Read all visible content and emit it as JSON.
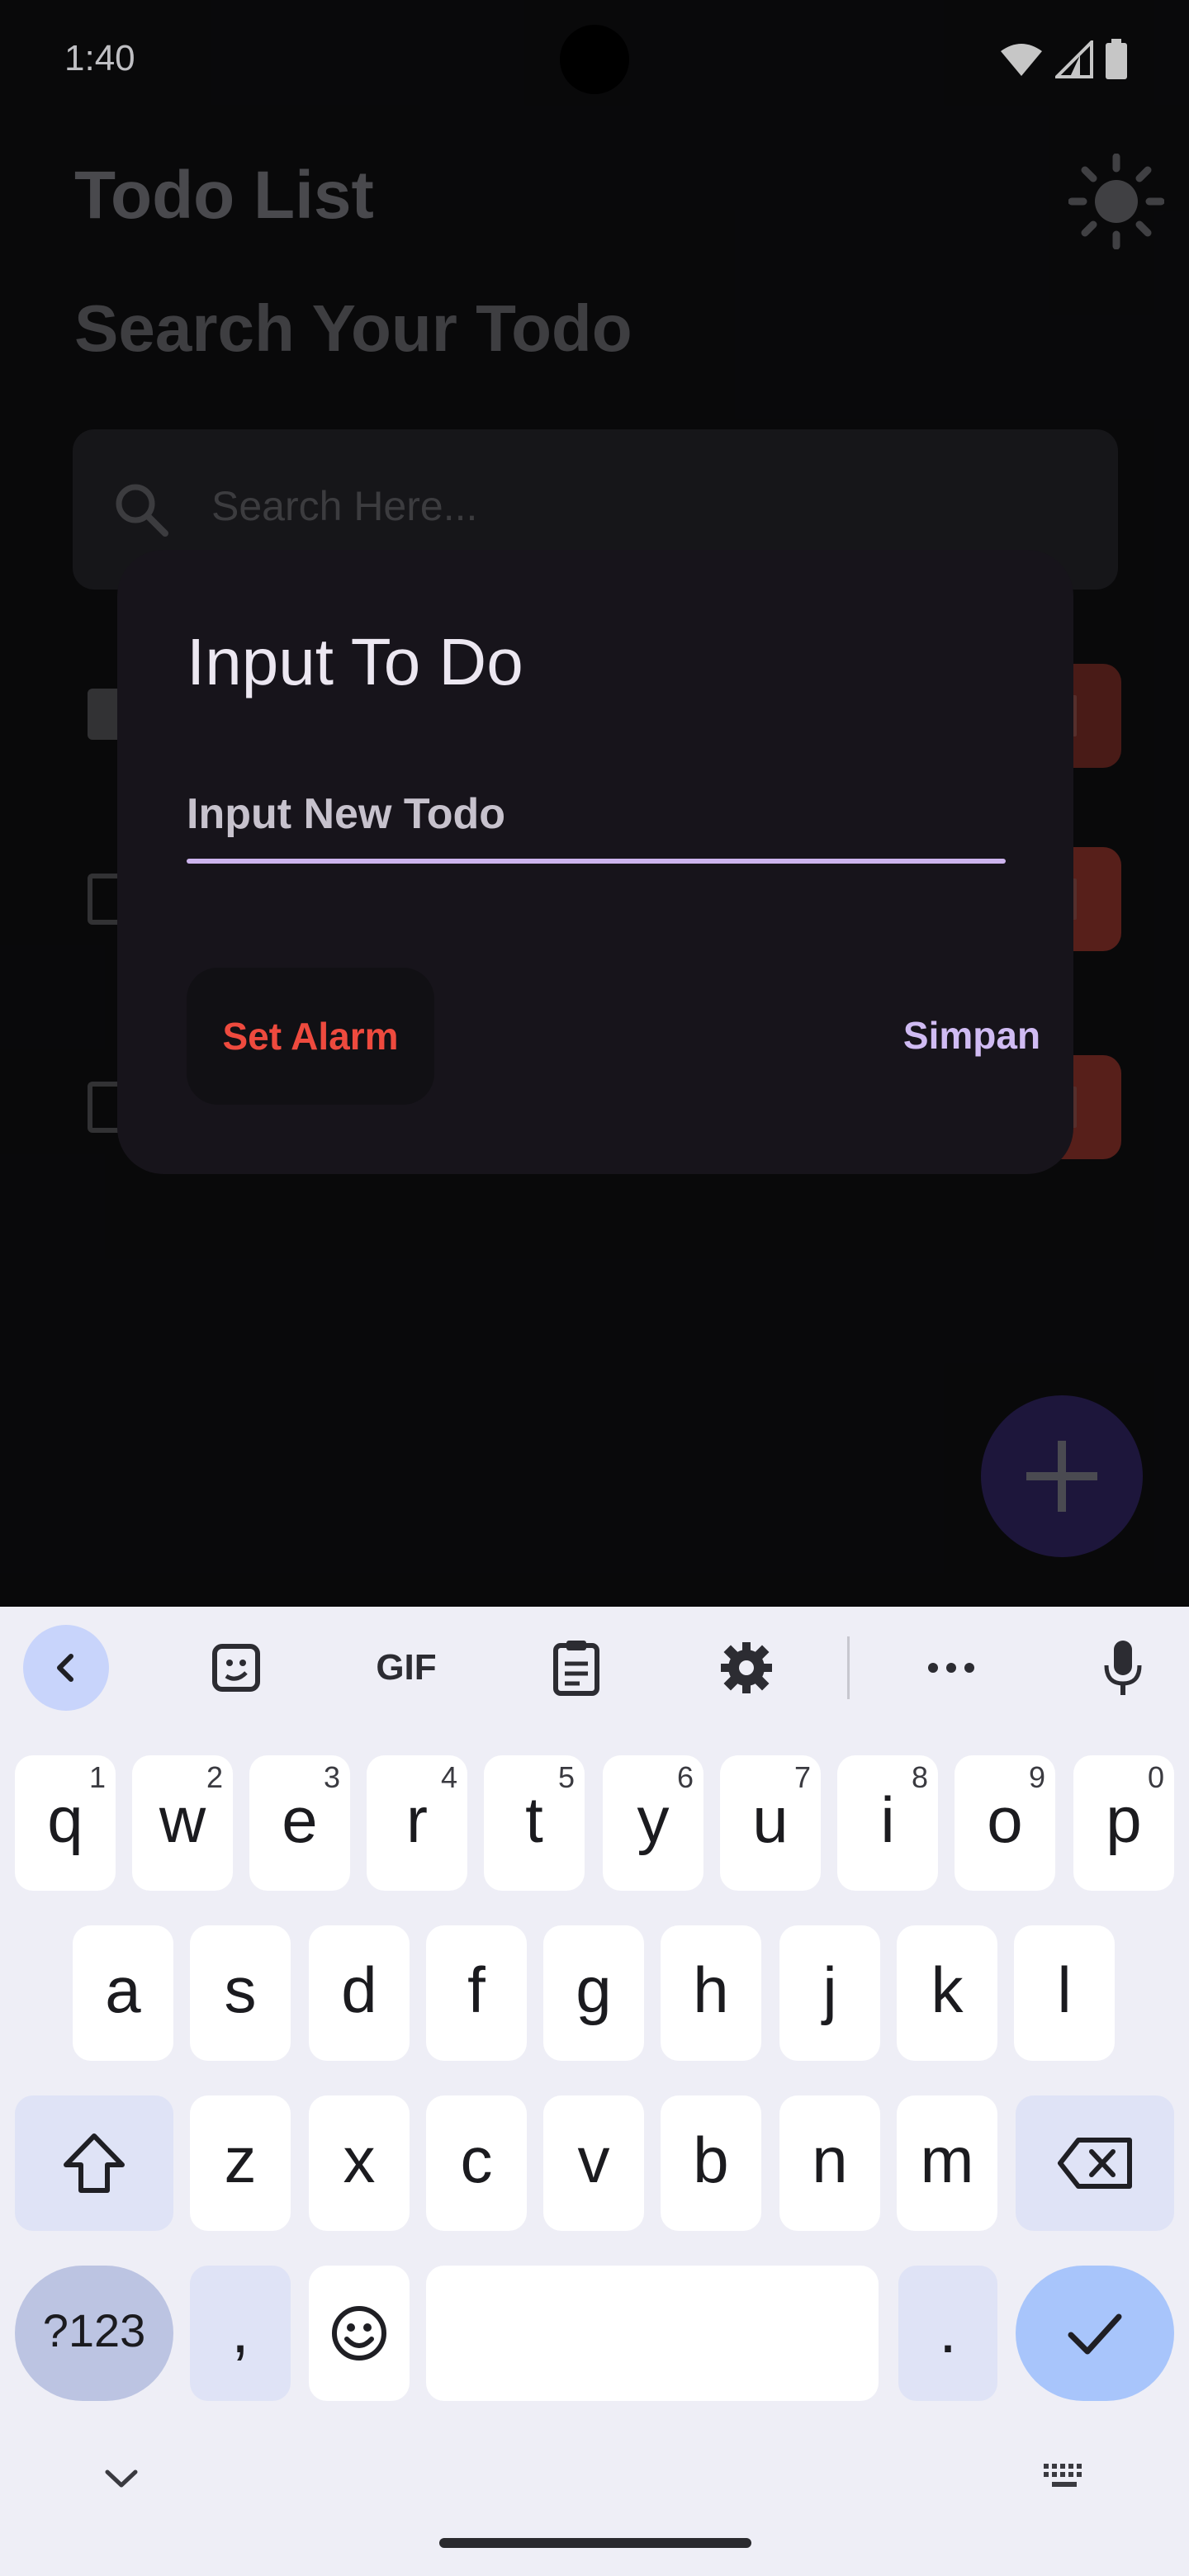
{
  "status_bar": {
    "time": "1:40",
    "icons": [
      "wifi-icon",
      "signal-icon",
      "battery-icon"
    ]
  },
  "app": {
    "title": "Todo List",
    "theme_icon": "sun-icon",
    "search_heading": "Search Your Todo",
    "search": {
      "placeholder": "Search Here...",
      "icon": "search-icon"
    },
    "todos": [
      {
        "checked": true
      },
      {
        "checked": false
      },
      {
        "checked": false
      }
    ],
    "fab_icon": "plus-icon"
  },
  "dialog": {
    "title": "Input To Do",
    "input_placeholder": "Input New Todo",
    "set_alarm_label": "Set Alarm",
    "save_label": "Simpan"
  },
  "keyboard": {
    "toolbar": [
      "back-icon",
      "sticker-icon",
      "gif-icon",
      "clipboard-icon",
      "settings-icon",
      "more-icon",
      "mic-icon"
    ],
    "gif_label": "GIF",
    "row1": [
      {
        "key": "q",
        "hint": "1"
      },
      {
        "key": "w",
        "hint": "2"
      },
      {
        "key": "e",
        "hint": "3"
      },
      {
        "key": "r",
        "hint": "4"
      },
      {
        "key": "t",
        "hint": "5"
      },
      {
        "key": "y",
        "hint": "6"
      },
      {
        "key": "u",
        "hint": "7"
      },
      {
        "key": "i",
        "hint": "8"
      },
      {
        "key": "o",
        "hint": "9"
      },
      {
        "key": "p",
        "hint": "0"
      }
    ],
    "row2": [
      "a",
      "s",
      "d",
      "f",
      "g",
      "h",
      "j",
      "k",
      "l"
    ],
    "row3": [
      "z",
      "x",
      "c",
      "v",
      "b",
      "n",
      "m"
    ],
    "symbols_label": "?123",
    "comma_label": ",",
    "period_label": "."
  },
  "colors": {
    "accent": "#cdb4ee",
    "danger": "#ee4a3e",
    "keyboard_enter": "#a8c5fb"
  }
}
